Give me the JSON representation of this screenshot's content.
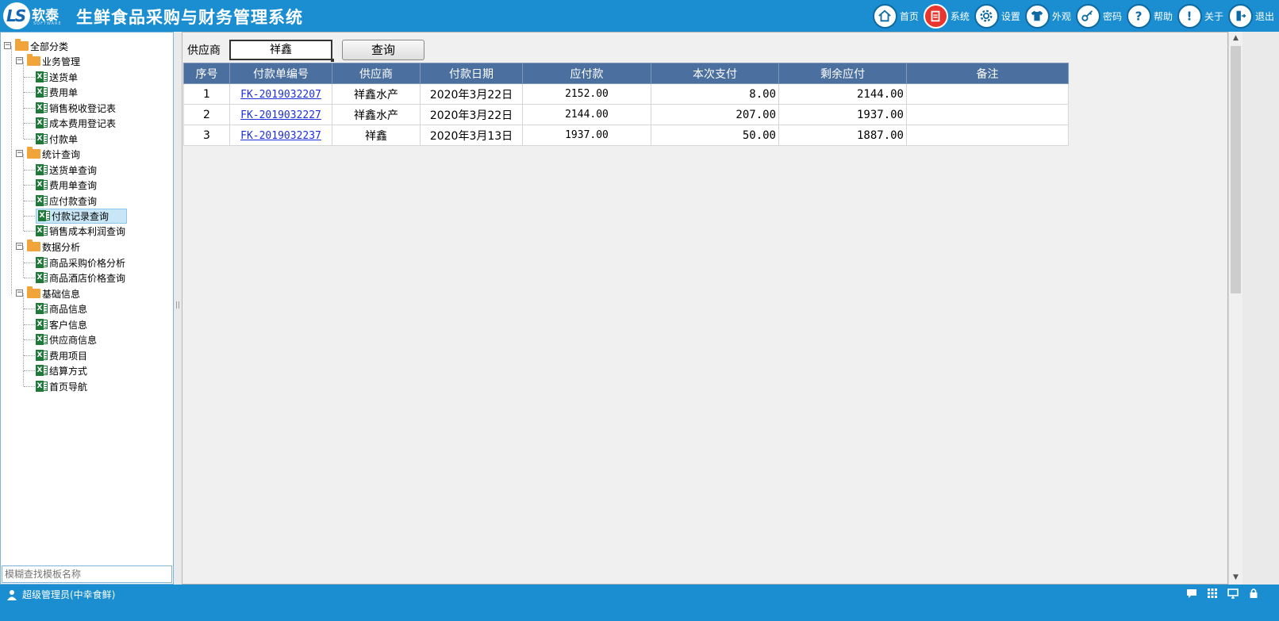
{
  "header": {
    "logo_text": "软泰",
    "logo_sub": "SOFTWARE",
    "app_title": "生鲜食品采购与财务管理系统",
    "nav": [
      {
        "label": "首页",
        "icon": "home-icon"
      },
      {
        "label": "系统",
        "icon": "system-icon"
      },
      {
        "label": "设置",
        "icon": "gear-icon"
      },
      {
        "label": "外观",
        "icon": "shirt-icon"
      },
      {
        "label": "密码",
        "icon": "key-icon"
      },
      {
        "label": "帮助",
        "icon": "help-icon"
      },
      {
        "label": "关于",
        "icon": "info-icon"
      },
      {
        "label": "退出",
        "icon": "exit-icon"
      }
    ]
  },
  "tree": {
    "root": "全部分类",
    "groups": [
      {
        "label": "业务管理",
        "items": [
          "送货单",
          "费用单",
          "销售税收登记表",
          "成本费用登记表",
          "付款单"
        ]
      },
      {
        "label": "统计查询",
        "items": [
          "送货单查询",
          "费用单查询",
          "应付款查询",
          "付款记录查询",
          "销售成本利润查询"
        ]
      },
      {
        "label": "数据分析",
        "items": [
          "商品采购价格分析",
          "商品酒店价格查询"
        ]
      },
      {
        "label": "基础信息",
        "items": [
          "商品信息",
          "客户信息",
          "供应商信息",
          "费用项目",
          "结算方式",
          "首页导航"
        ]
      }
    ],
    "selected": "付款记录查询",
    "search_placeholder": "模糊查找模板名称"
  },
  "filter": {
    "supplier_label": "供应商",
    "supplier_value": "祥鑫",
    "query_button": "查询"
  },
  "table": {
    "columns": [
      "序号",
      "付款单编号",
      "供应商",
      "付款日期",
      "应付款",
      "本次支付",
      "剩余应付",
      "备注"
    ],
    "rows": [
      {
        "index": "1",
        "code": "FK-2019032207",
        "supplier": "祥鑫水产",
        "date": "2020年3月22日",
        "payable": "2152.00",
        "paid": "8.00",
        "remaining": "2144.00",
        "note": ""
      },
      {
        "index": "2",
        "code": "FK-2019032227",
        "supplier": "祥鑫水产",
        "date": "2020年3月22日",
        "payable": "2144.00",
        "paid": "207.00",
        "remaining": "1937.00",
        "note": ""
      },
      {
        "index": "3",
        "code": "FK-2019032237",
        "supplier": "祥鑫",
        "date": "2020年3月13日",
        "payable": "1937.00",
        "paid": "50.00",
        "remaining": "1887.00",
        "note": ""
      }
    ]
  },
  "status": {
    "user": "超级管理员(中幸食鲜)"
  },
  "colors": {
    "header_bg": "#1a8ed0",
    "table_header_bg": "#4b70a0",
    "link": "#1f2fd8"
  }
}
